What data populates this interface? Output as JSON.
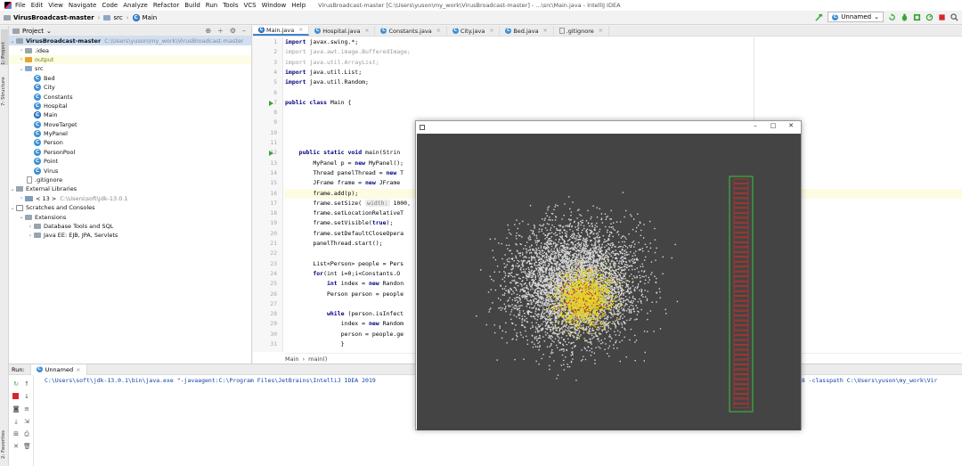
{
  "menu": {
    "items": [
      "File",
      "Edit",
      "View",
      "Navigate",
      "Code",
      "Analyze",
      "Refactor",
      "Build",
      "Run",
      "Tools",
      "VCS",
      "Window",
      "Help"
    ],
    "window_title": "VirusBroadcast-master [C:\\Users\\yuson\\my_work\\VirusBroadcast-master] - ...\\src\\Main.java - IntelliJ IDEA"
  },
  "nav": {
    "breadcrumb": [
      "VirusBroadcast-master",
      "src",
      "Main"
    ],
    "run_config": "Unnamed"
  },
  "stripe": {
    "project": "1: Project",
    "favorites": "2: Favorites",
    "structure": "7: Structure"
  },
  "project": {
    "header": "Project",
    "root": {
      "name": "VirusBroadcast-master",
      "path": "C:\\Users\\yuson\\my_work\\VirusBroadcast-master"
    },
    "items": {
      "idea": ".idea",
      "output": "output",
      "src": "src",
      "classes": [
        "Bed",
        "City",
        "Constants",
        "Hospital",
        "Main",
        "MoveTarget",
        "MyPanel",
        "Person",
        "PersonPool",
        "Point",
        "Virus"
      ],
      "gitignore": ".gitignore",
      "external_libraries": "External Libraries",
      "jdk": "< 13 >",
      "jdk_path": "C:\\Users\\soft\\jdk-13.0.1",
      "scratches": "Scratches and Consoles",
      "extensions": "Extensions",
      "db_tools": "Database Tools and SQL",
      "java_ee": "Java EE: EJB, JPA, Servlets"
    }
  },
  "editor": {
    "tabs": [
      "Main.java",
      "Hospital.java",
      "Constants.java",
      "City.java",
      "Bed.java",
      ".gitignore"
    ],
    "line_numbers": [
      "1",
      "2",
      "3",
      "4",
      "5",
      "6",
      "7",
      "8",
      "9",
      "10",
      "11",
      "12",
      "13",
      "14",
      "15",
      "16",
      "17",
      "18",
      "19",
      "20",
      "21",
      "22",
      "23",
      "24",
      "25",
      "26",
      "27",
      "28",
      "29",
      "30",
      "31"
    ],
    "code": {
      "l1": "javax.swing.*;",
      "l2": "java.awt.image.BufferedImage;",
      "l3": "java.util.ArrayList;",
      "l4": "java.util.List;",
      "l5": "java.util.Random;",
      "l7_name": "Main {",
      "l12": "main(Strin",
      "l13a": "MyPanel p = ",
      "l13b": "MyPanel();",
      "l14a": "Thread panelThread = ",
      "l14b": "T",
      "l15a": "JFrame frame = ",
      "l15b": "JFrame",
      "l16": "frame.add(p);",
      "l17a": "frame.setSize(",
      "l17_hint": "width:",
      "l17b": "1000,",
      "l18": "frame.setLocationRelativeT",
      "l19a": "frame.setVisible(",
      "l19b": "true",
      "l19c": ");",
      "l20": "frame.setDefaultCloseOpera",
      "l21": "panelThread.start();",
      "l23": "List<Person> people = Pers",
      "l24a": "for",
      "l24b": "(int i=0;i<Constants.O",
      "l25a": "int",
      "l25b": "index = ",
      "l25c": "Randon",
      "l26": "Person person = people",
      "l28a": "while",
      "l28b": "(person.isInfect",
      "l29a": "index = ",
      "l29b": "Random",
      "l30": "person = people.ge",
      "l31": "}"
    },
    "keywords": {
      "import": "import",
      "public": "public",
      "class": "class",
      "static": "static",
      "void": "void",
      "new": "new"
    },
    "breadcrumb": [
      "Main",
      "main()"
    ]
  },
  "run": {
    "label": "Run:",
    "tab": "Unnamed",
    "command": "C:\\Users\\soft\\jdk-13.0.1\\bin\\java.exe \"-javaagent:C:\\Program Files\\JetBrains\\IntelliJ IDEA 2019",
    "command_tail": "F-8 -classpath C:\\Users\\yuson\\my_work\\Vir"
  },
  "colors": {
    "canvas_bg": "#444444",
    "healthy": "#d9d9d9",
    "infected": "#e6d21a",
    "confirmed": "#d0352a",
    "hospital_border": "#3bc43b",
    "hospital_bed": "#b8342c"
  },
  "simulation": {
    "healthy_count": 5200,
    "infected_count": 1400,
    "confirmed_count": 90,
    "hospital_beds": 47
  }
}
